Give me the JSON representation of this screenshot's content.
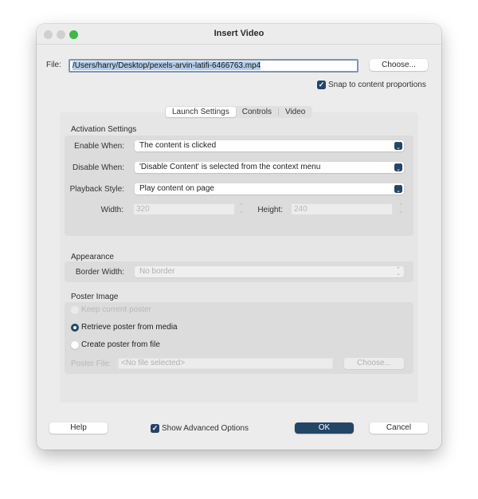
{
  "window": {
    "title": "Insert Video",
    "controls": [
      "close",
      "minimize",
      "zoom"
    ]
  },
  "file": {
    "label": "File:",
    "value": "/Users/harry/Desktop/pexels-arvin-latifi-6466763.mp4",
    "choose_label": "Choose..."
  },
  "snap": {
    "label": "Snap to content proportions",
    "checked": true,
    "check_glyph": "✓"
  },
  "tabs": [
    {
      "label": "Launch Settings",
      "active": true
    },
    {
      "label": "Controls",
      "active": false
    },
    {
      "label": "Video",
      "active": false
    }
  ],
  "activation": {
    "title": "Activation Settings",
    "enable_when": {
      "label": "Enable When:",
      "value": "The content is clicked"
    },
    "disable_when": {
      "label": "Disable When:",
      "value": "'Disable Content' is selected from the context menu"
    },
    "playback_style": {
      "label": "Playback Style:",
      "value": "Play content on page"
    },
    "width": {
      "label": "Width:",
      "value": "320"
    },
    "height": {
      "label": "Height:",
      "value": "240"
    },
    "select_arrows_glyph": "⌃⌄",
    "stepper_glyph": "⌃⌄"
  },
  "appearance": {
    "title": "Appearance",
    "border_width": {
      "label": "Border Width:",
      "value": "No border"
    }
  },
  "poster": {
    "title": "Poster Image",
    "options": [
      {
        "label": "Keep current poster",
        "checked": false,
        "disabled": true
      },
      {
        "label": "Retrieve poster from media",
        "checked": true,
        "disabled": false
      },
      {
        "label": "Create poster from file",
        "checked": false,
        "disabled": false
      }
    ],
    "file_label": "Poster File:",
    "file_placeholder": "<No file selected>",
    "choose_label": "Choose..."
  },
  "footer": {
    "help_label": "Help",
    "advanced_label": "Show Advanced Options",
    "advanced_checked": true,
    "ok_label": "OK",
    "cancel_label": "Cancel"
  },
  "colors": {
    "accent": "#234566",
    "window_bg": "#ececec",
    "panel_bg": "#e6e6e6",
    "group_bg": "#dcdcdc",
    "traffic_green": "#3fb84a",
    "selection": "#b3cde8"
  }
}
